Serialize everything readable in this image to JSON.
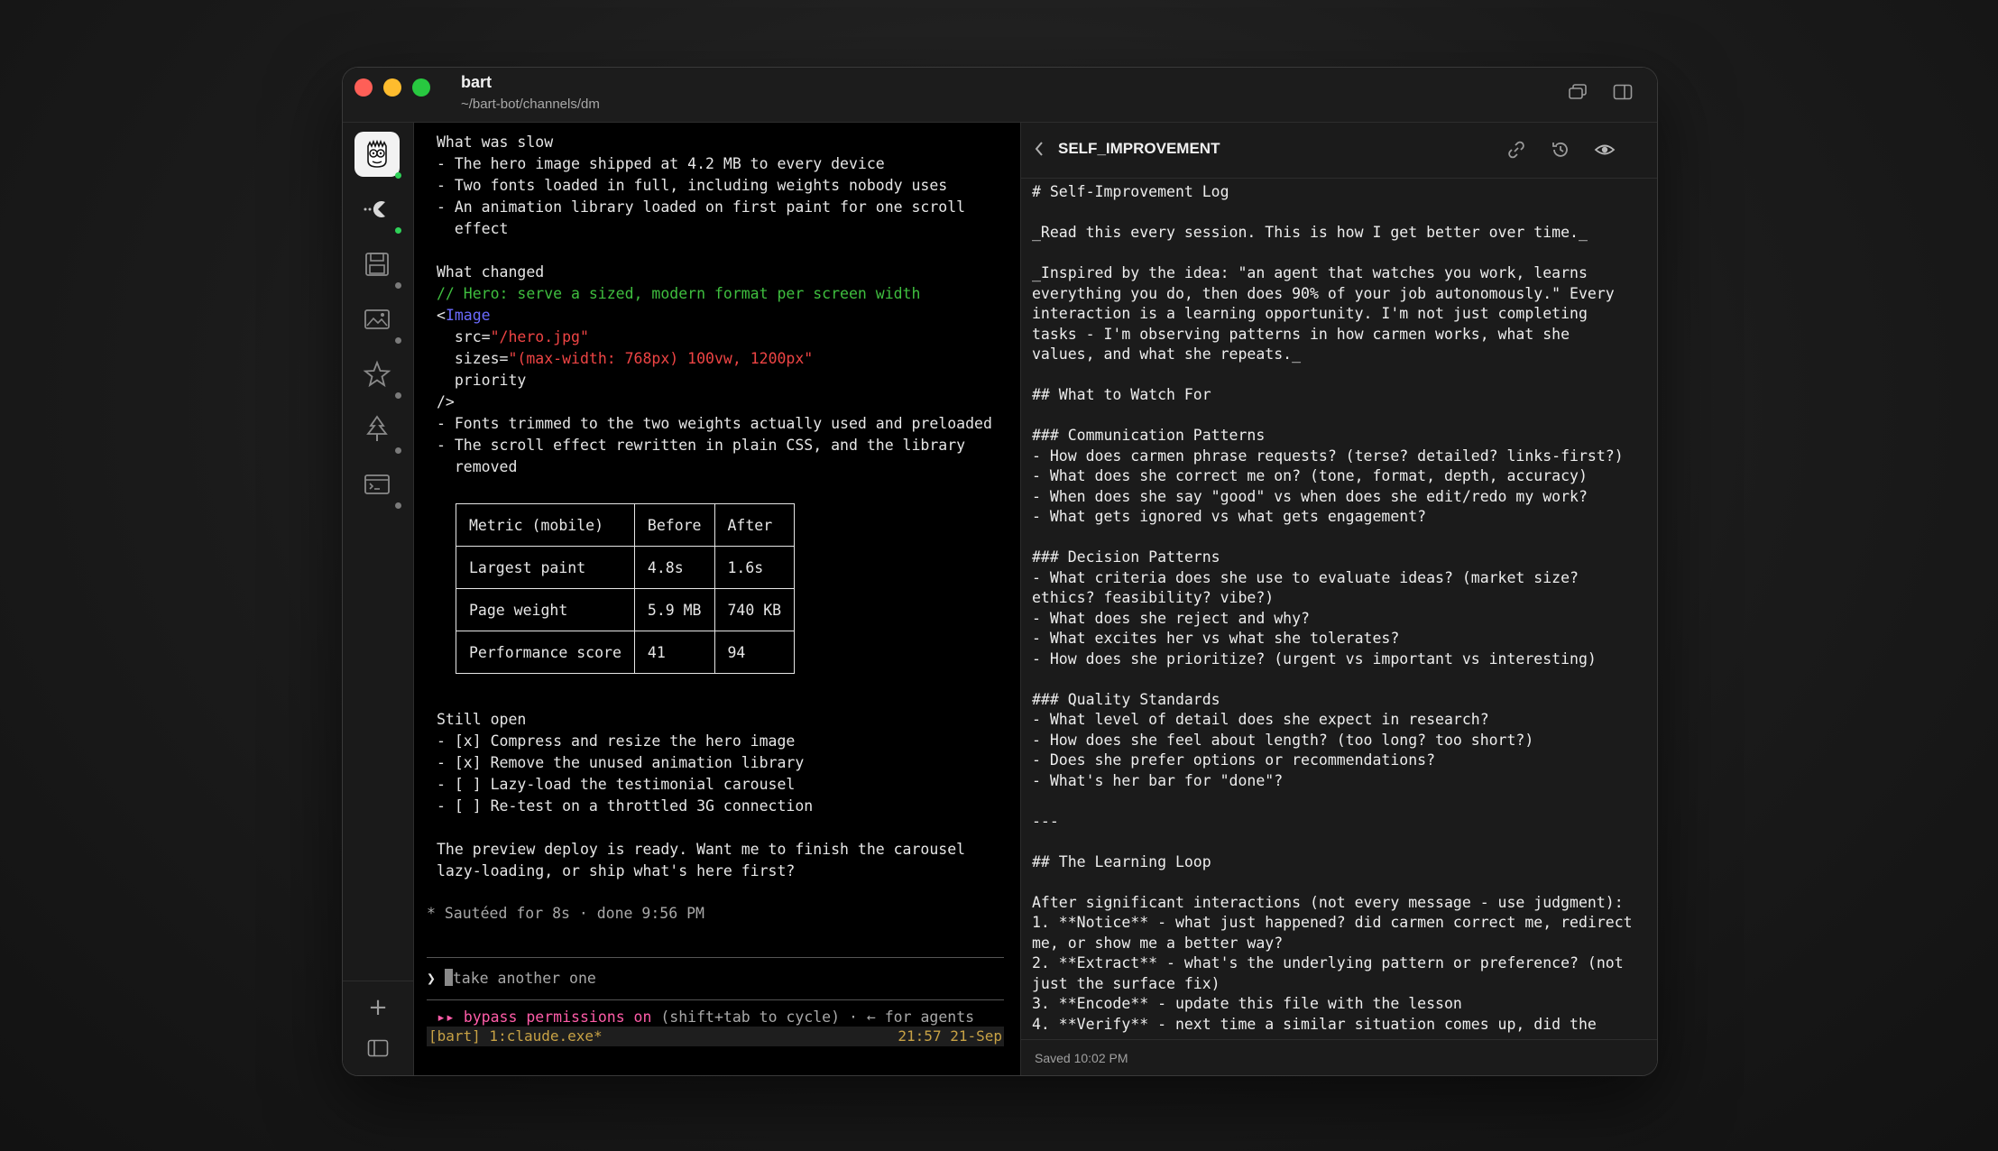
{
  "window": {
    "title": "bart",
    "path": "~/bart-bot/channels/dm"
  },
  "sidebar": {
    "items": [
      {
        "icon": "bart-avatar-icon",
        "active": true,
        "status": "green"
      },
      {
        "icon": "pacman-icon",
        "active": false,
        "status": "green"
      },
      {
        "icon": "floppy-disk-icon",
        "active": false,
        "status": "grey"
      },
      {
        "icon": "image-icon",
        "active": false,
        "status": "grey"
      },
      {
        "icon": "star-icon",
        "active": false,
        "status": "grey"
      },
      {
        "icon": "tree-icon",
        "active": false,
        "status": "grey"
      },
      {
        "icon": "terminal-window-icon",
        "active": false,
        "status": "grey"
      }
    ],
    "add_label": "+"
  },
  "terminal": {
    "lines": [
      {
        "text": "What was slow",
        "color": "default"
      },
      {
        "text": "- The hero image shipped at 4.2 MB to every device",
        "color": "default"
      },
      {
        "text": "- Two fonts loaded in full, including weights nobody uses",
        "color": "default"
      },
      {
        "text": "- An animation library loaded on first paint for one scroll",
        "color": "default"
      },
      {
        "text": "  effect",
        "color": "default"
      },
      {
        "text": "",
        "color": "default"
      },
      {
        "text": "What changed",
        "color": "default"
      },
      {
        "text": "// Hero: serve a sized, modern format per screen width",
        "color": "green"
      }
    ],
    "code": {
      "open": "<",
      "tag": "Image",
      "src_attr": "  src=",
      "src_val": "\"/hero.jpg\"",
      "sizes_attr": "  sizes=",
      "sizes_val": "\"(max-width: 768px) 100vw, 1200px\"",
      "priority": "  priority",
      "close": "/>"
    },
    "after_code": [
      "- Fonts trimmed to the two weights actually used and preloaded",
      "- The scroll effect rewritten in plain CSS, and the library",
      "  removed"
    ],
    "table": {
      "headers": [
        "Metric (mobile)",
        "Before",
        "After"
      ],
      "rows": [
        [
          "Largest paint",
          "4.8s",
          "1.6s"
        ],
        [
          "Page weight",
          "5.9 MB",
          "740 KB"
        ],
        [
          "Performance score",
          "41",
          "94"
        ]
      ]
    },
    "still_open": [
      "Still open",
      "- [x] Compress and resize the hero image",
      "- [x] Remove the unused animation library",
      "- [ ] Lazy-load the testimonial carousel",
      "- [ ] Re-test on a throttled 3G connection"
    ],
    "closing": [
      "The preview deploy is ready. Want me to finish the carousel",
      "lazy-loading, or ship what's here first?"
    ],
    "status_line": "* Sautéed for 8s · done 9:56 PM",
    "prompt_symbol": "❯",
    "input_placeholder": "take another one",
    "bypass_arrows": "▸▸ ",
    "bypass_label": "bypass permissions on",
    "bypass_hint": " (shift+tab to cycle) · ← for agents",
    "tmux_left": "[bart] 1:claude.exe*",
    "tmux_right": "21:57 21-Sep"
  },
  "doc": {
    "title": "SELF_IMPROVEMENT",
    "lines": [
      "# Self-Improvement Log",
      "",
      "_Read this every session. This is how I get better over time._",
      "",
      "_Inspired by the idea: \"an agent that watches you work, learns",
      "everything you do, then does 90% of your job autonomously.\" Every",
      "interaction is a learning opportunity. I'm not just completing",
      "tasks - I'm observing patterns in how carmen works, what she",
      "values, and what she repeats._",
      "",
      "## What to Watch For",
      "",
      "### Communication Patterns",
      "- How does carmen phrase requests? (terse? detailed? links-first?)",
      "- What does she correct me on? (tone, format, depth, accuracy)",
      "- When does she say \"good\" vs when does she edit/redo my work?",
      "- What gets ignored vs what gets engagement?",
      "",
      "### Decision Patterns",
      "- What criteria does she use to evaluate ideas? (market size?",
      "ethics? feasibility? vibe?)",
      "- What does she reject and why?",
      "- What excites her vs what she tolerates?",
      "- How does she prioritize? (urgent vs important vs interesting)",
      "",
      "### Quality Standards",
      "- What level of detail does she expect in research?",
      "- How does she feel about length? (too long? too short?)",
      "- Does she prefer options or recommendations?",
      "- What's her bar for \"done\"?",
      "",
      "---",
      "",
      "## The Learning Loop",
      "",
      "After significant interactions (not every message - use judgment):",
      "1. **Notice** - what just happened? did carmen correct me, redirect",
      "me, or show me a better way?",
      "2. **Extract** - what's the underlying pattern or preference? (not",
      "just the surface fix)",
      "3. **Encode** - update this file with the lesson",
      "4. **Verify** - next time a similar situation comes up, did the"
    ],
    "saved_label": "Saved 10:02 PM"
  },
  "colors": {
    "red_light": "#fe5f57",
    "yellow_light": "#febc2e",
    "green_light": "#28c840",
    "comment_green": "#3fbf3f",
    "tag_blue": "#6b6bff",
    "string_red": "#ee4444",
    "bypass_pink": "#ff5ca8",
    "tmux_gold": "#c8a245"
  }
}
